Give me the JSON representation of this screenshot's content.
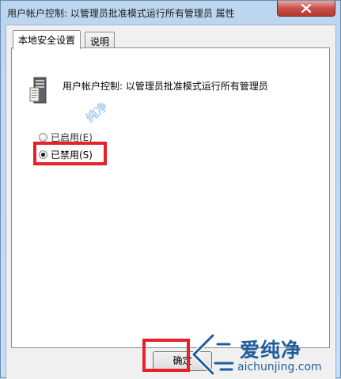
{
  "window": {
    "title": "用户帐户控制: 以管理员批准模式运行所有管理员 属性"
  },
  "titlebar": {
    "close_icon": "close-icon"
  },
  "tabs": [
    {
      "label": "本地安全设置",
      "active": true
    },
    {
      "label": "说明",
      "active": false
    }
  ],
  "policy": {
    "icon": "server-icon",
    "name": "用户帐户控制: 以管理员批准模式运行所有管理员"
  },
  "options": {
    "enabled_label": "已启用(E)",
    "disabled_label": "已禁用(S)",
    "selected": "disabled"
  },
  "buttons": {
    "ok_label": "确定"
  },
  "watermark": {
    "small_text": "纯净",
    "brand": "爱纯净",
    "url": "aichunjing.com"
  },
  "colors": {
    "highlight_red": "#e8202a",
    "brand_blue": "#1f5d9e"
  }
}
